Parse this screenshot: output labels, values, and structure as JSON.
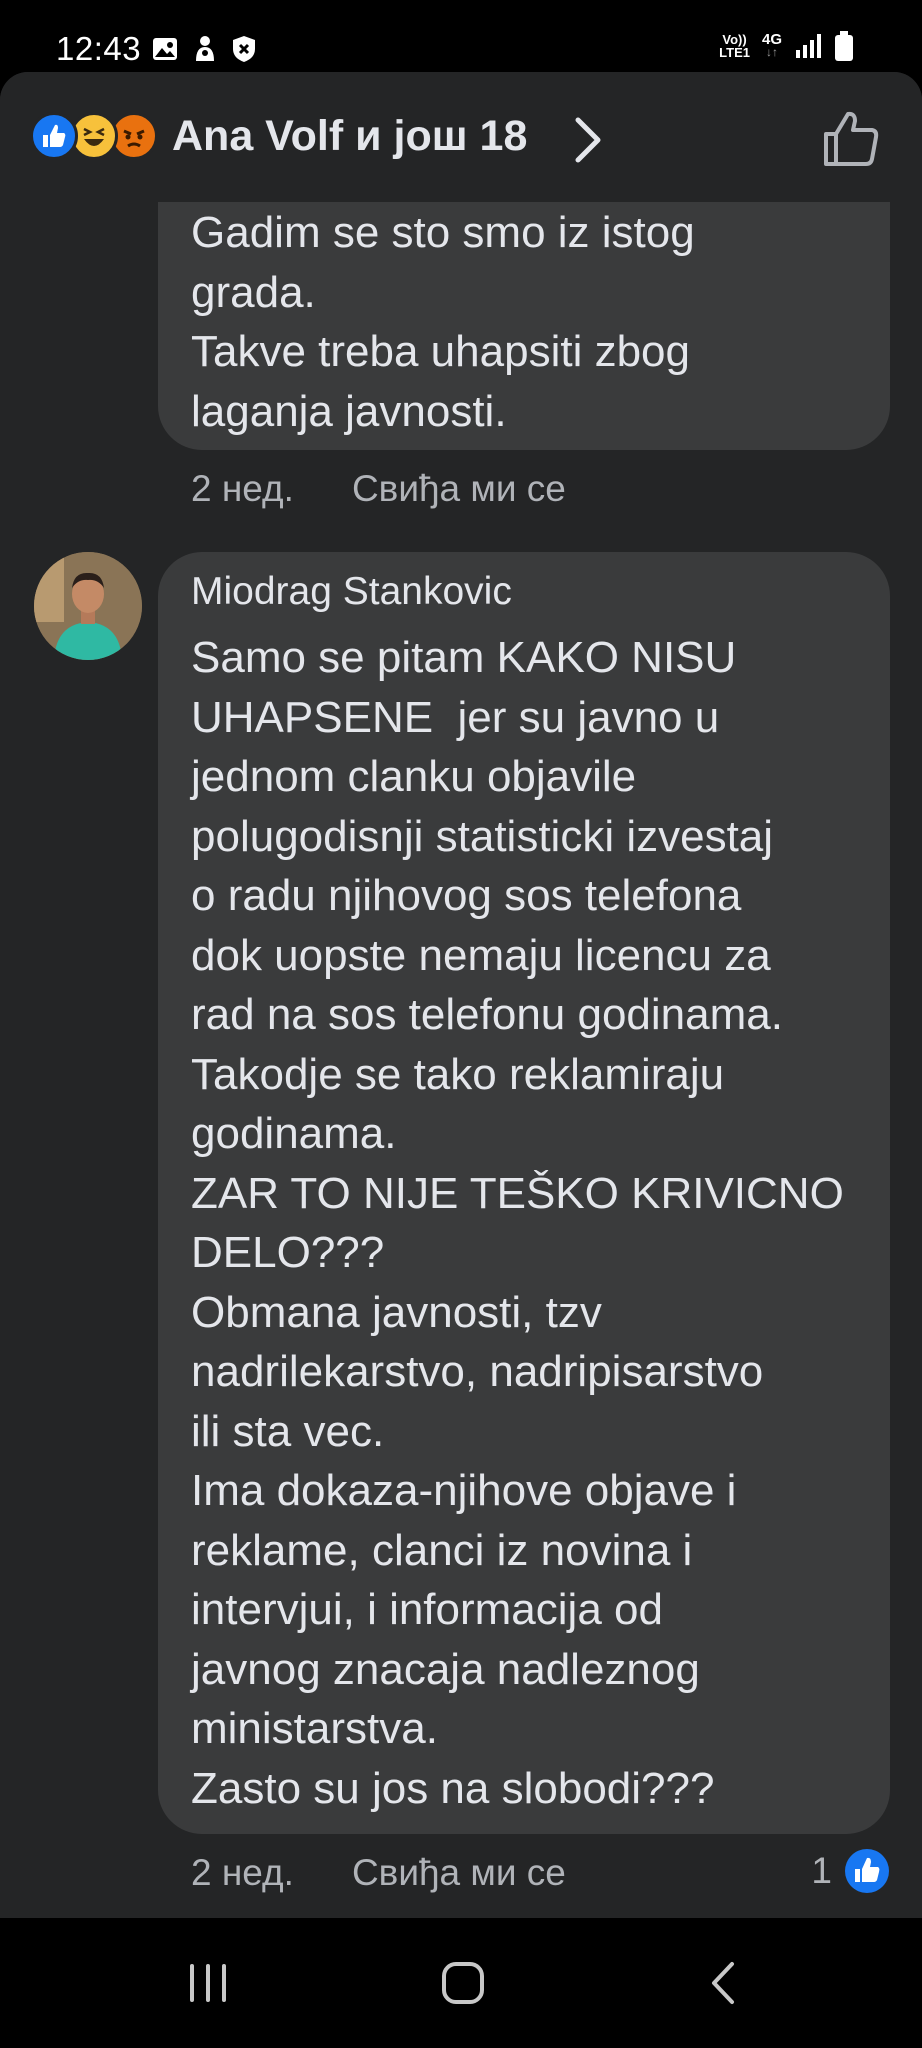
{
  "status": {
    "time": "12:43",
    "network_top": "Vo))",
    "network_bottom": "LTE1",
    "network_type": "4G",
    "icons_left": [
      "image-icon",
      "bixby-icon",
      "shield-icon"
    ],
    "icons_right": [
      "volte-icon",
      "4g-icon",
      "signal-icon",
      "battery-icon"
    ]
  },
  "header": {
    "title": "Ana Volf и још 18",
    "reactions": [
      "like-reaction-icon",
      "haha-reaction-icon",
      "angry-reaction-icon"
    ],
    "colors": {
      "like": "#1877f2",
      "haha": "#f7c13b",
      "angry": "#e9710f"
    }
  },
  "comments": [
    {
      "text": "Gadim se sto smo iz istog\ngrada.\nTakve treba uhapsiti zbog\nlaganja javnosti.",
      "time": "2 нед.",
      "like_label": "Свиђа ми се"
    },
    {
      "author": "Miodrag Stankovic",
      "text": "Samo se pitam KAKO NISU\nUHAPSENE  jer su javno u\njednom clanku objavile\npolugodisnji statisticki izvestaj\no radu njihovog sos telefona\ndok uopste nemaju licencu za\nrad na sos telefonu godinama.\nTakodje se tako reklamiraju\ngodinama.\nZAR TO NIJE TEŠKO KRIVICNO\nDELO???\nObmana javnosti, tzv\nnadrilekarstvo, nadripisarstvo\nili sta vec.\nIma dokaza-njihove objave i\nreklame, clanci iz novina i\nintervjui, i informacija od\njavnog znacaja nadleznog\nministarstva.\nZasto su jos na slobodi???",
      "time": "2 нед.",
      "like_label": "Свиђа ми се",
      "like_count": "1"
    }
  ],
  "nav": [
    "recent-apps-icon",
    "home-icon",
    "back-icon"
  ]
}
